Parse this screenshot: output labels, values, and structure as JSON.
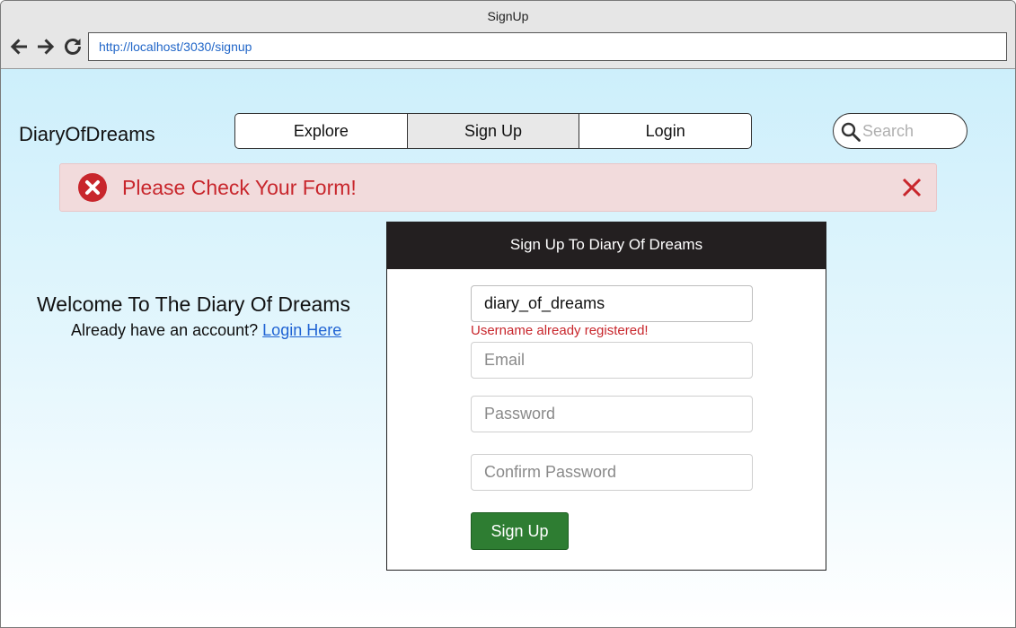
{
  "window": {
    "title": "SignUp"
  },
  "browser": {
    "url": "http://localhost/3030/signup"
  },
  "header": {
    "brand": "DiaryOfDreams",
    "nav": [
      {
        "label": "Explore"
      },
      {
        "label": "Sign Up",
        "active": true
      },
      {
        "label": "Login"
      }
    ],
    "search_placeholder": "Search"
  },
  "alert": {
    "message": "Please Check Your Form!"
  },
  "welcome": {
    "heading": "Welcome To The Diary Of Dreams",
    "prompt": "Already have an account?",
    "link": "Login Here"
  },
  "form": {
    "title": "Sign Up To Diary Of Dreams",
    "username_value": "diary_of_dreams",
    "username_error": "Username already registered!",
    "email_placeholder": "Email",
    "password_placeholder": "Password",
    "confirm_placeholder": "Confirm Password",
    "submit_label": "Sign Up"
  },
  "colors": {
    "error": "#c8262c",
    "alert_bg": "#f2dbdc",
    "submit": "#2e7d32",
    "card_header": "#231f20",
    "link": "#1f63d3"
  },
  "icons": [
    "back-arrow-icon",
    "forward-arrow-icon",
    "reload-icon",
    "search-icon",
    "error-circle-icon",
    "close-icon"
  ]
}
